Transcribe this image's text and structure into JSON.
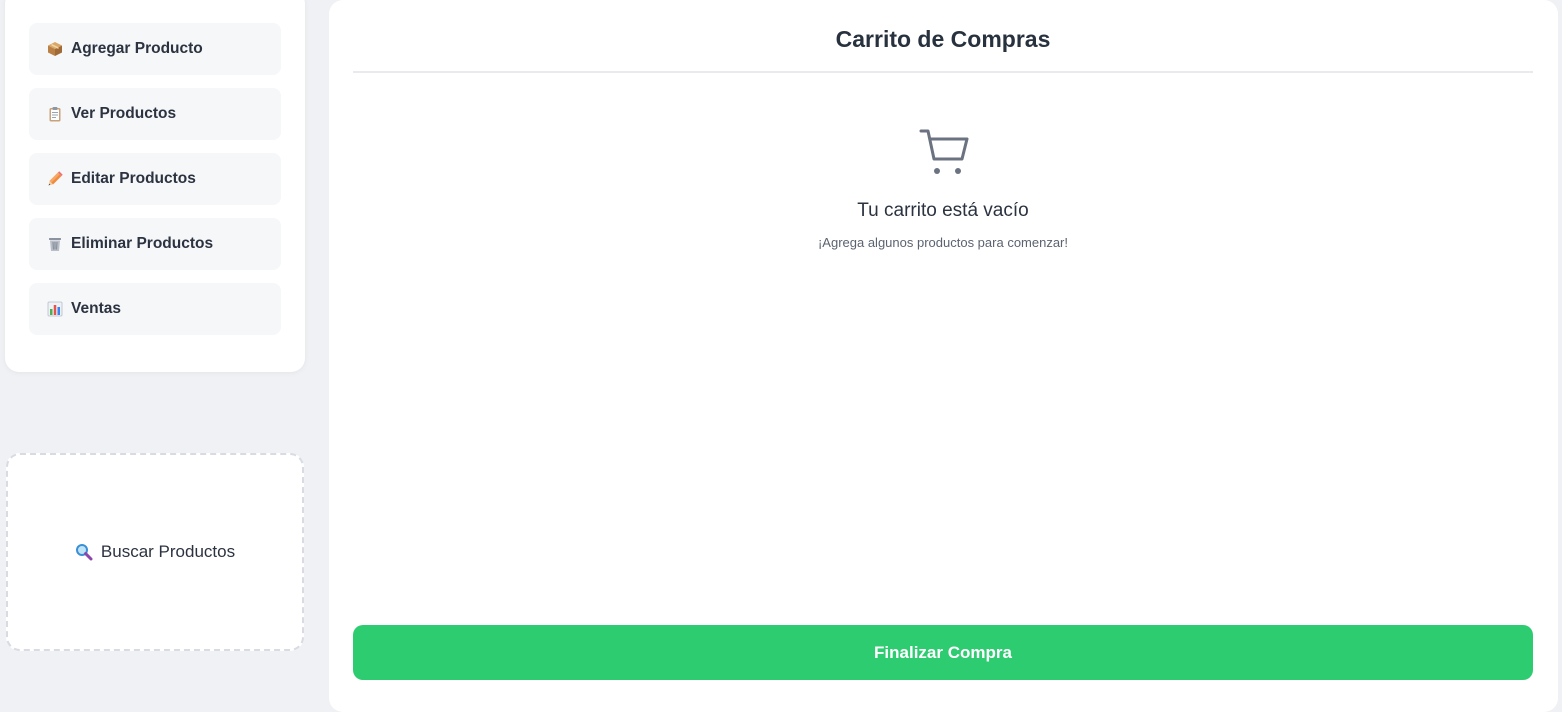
{
  "sidebar": {
    "items": [
      {
        "label": "Agregar Producto",
        "icon": "package-icon"
      },
      {
        "label": "Ver Productos",
        "icon": "clipboard-icon"
      },
      {
        "label": "Editar Productos",
        "icon": "pencil-icon"
      },
      {
        "label": "Eliminar Productos",
        "icon": "wastebasket-icon"
      },
      {
        "label": "Ventas",
        "icon": "bar-chart-icon"
      }
    ]
  },
  "search": {
    "label": "Buscar Productos",
    "icon": "magnifier-icon"
  },
  "cart": {
    "title": "Carrito de Compras",
    "empty_title": "Tu carrito está vacío",
    "empty_subtitle": "¡Agrega algunos productos para comenzar!",
    "empty_icon": "cart-icon",
    "checkout_label": "Finalizar Compra"
  },
  "colors": {
    "background": "#f0f1f4",
    "accent_green": "#2ecc71",
    "text_dark": "#2c3340",
    "muted_text": "#5c6370",
    "icon_gray": "#6b7280"
  }
}
